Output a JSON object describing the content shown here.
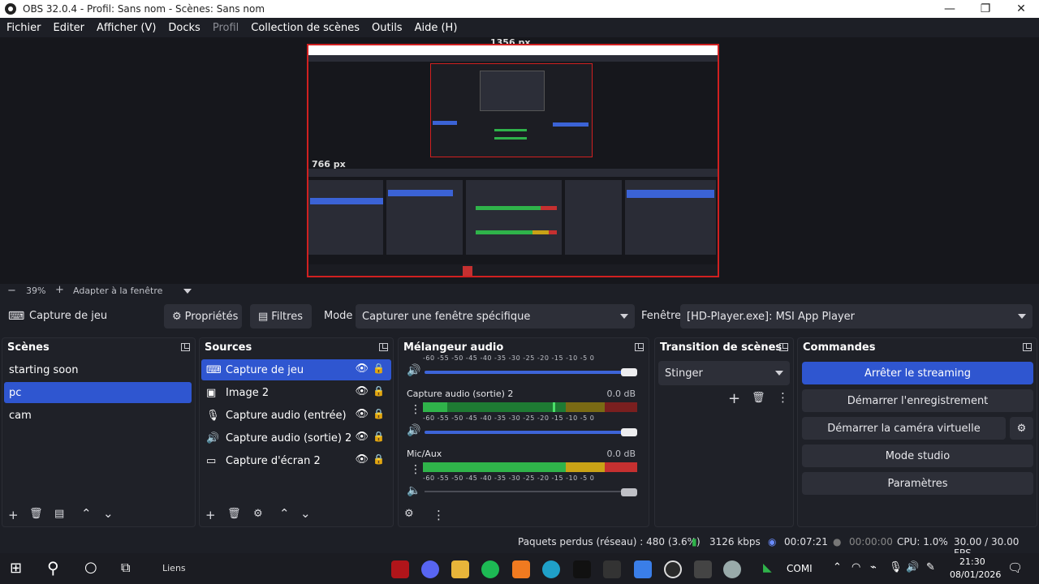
{
  "window": {
    "title": "OBS 32.0.4 - Profil: Sans nom - Scènes: Sans nom",
    "controls": [
      "—",
      "❐",
      "✕"
    ]
  },
  "menu": [
    "Fichier",
    "Editer",
    "Afficher (V)",
    "Docks",
    "Profil",
    "Outils",
    "Aide (H)"
  ],
  "preview": {
    "top_label": "1356 px",
    "inner_label": "766 px"
  },
  "zoom": {
    "minus": "−",
    "value": "39%",
    "plus": "+",
    "fit": "Adapter à la fenêtre"
  },
  "source_toolbar": {
    "source_name": "Capture de jeu",
    "properties": "Propriétés",
    "filters": "Filtres",
    "mode_label": "Mode",
    "mode_value": "Capturer une fenêtre spécifique",
    "window_label": "Fenêtre",
    "window_value": "[HD-Player.exe]: MSI App Player"
  },
  "scenes": {
    "title": "Scènes",
    "items": [
      "starting soon",
      "pc",
      "cam"
    ],
    "selected": "pc"
  },
  "sources": {
    "title": "Sources",
    "items": [
      {
        "label": "Capture de jeu",
        "icon": "gamepad-icon"
      },
      {
        "label": "Image 2",
        "icon": "image-icon"
      },
      {
        "label": "Capture audio (entrée)",
        "icon": "microphone-icon"
      },
      {
        "label": "Capture audio (sortie) 2",
        "icon": "speaker-icon"
      },
      {
        "label": "Capture d'écran 2",
        "icon": "monitor-icon"
      }
    ]
  },
  "mixer": {
    "title": "Mélangeur audio",
    "scale": "-60  -55  -50  -45  -40  -35  -30  -25  -20  -15  -10  -5  0",
    "channels": [
      {
        "name": "Capture audio (sortie) 2",
        "db": "0.0 dB",
        "level": 0.72
      },
      {
        "name": "Mic/Aux",
        "db": "0.0 dB",
        "level": 0.88
      }
    ]
  },
  "transition": {
    "title": "Transition de scènes",
    "value": "Stinger"
  },
  "commands": {
    "title": "Commandes",
    "buttons": [
      "Arrêter le streaming",
      "Démarrer l'enregistrement",
      "Démarrer la caméra virtuelle",
      "Mode studio",
      "Paramètres"
    ]
  },
  "status": {
    "dropped": "Paquets perdus (réseau) : 480 (3.6%)",
    "bitrate": "3126 kbps",
    "stream_time": "00:07:21",
    "rec_time": "00:00:00",
    "cpu": "CPU: 1.0%",
    "fps": "30.00 / 30.00 FPS"
  },
  "taskbar": {
    "links": "Liens",
    "comi": "COMI",
    "time": "21:30",
    "date": "08/01/2026"
  },
  "colors": {
    "accent": "#2f56d0",
    "meter_green": "#2fb34a",
    "meter_yellow": "#c9a216",
    "meter_red": "#c53030",
    "preview_border": "#d02020"
  }
}
